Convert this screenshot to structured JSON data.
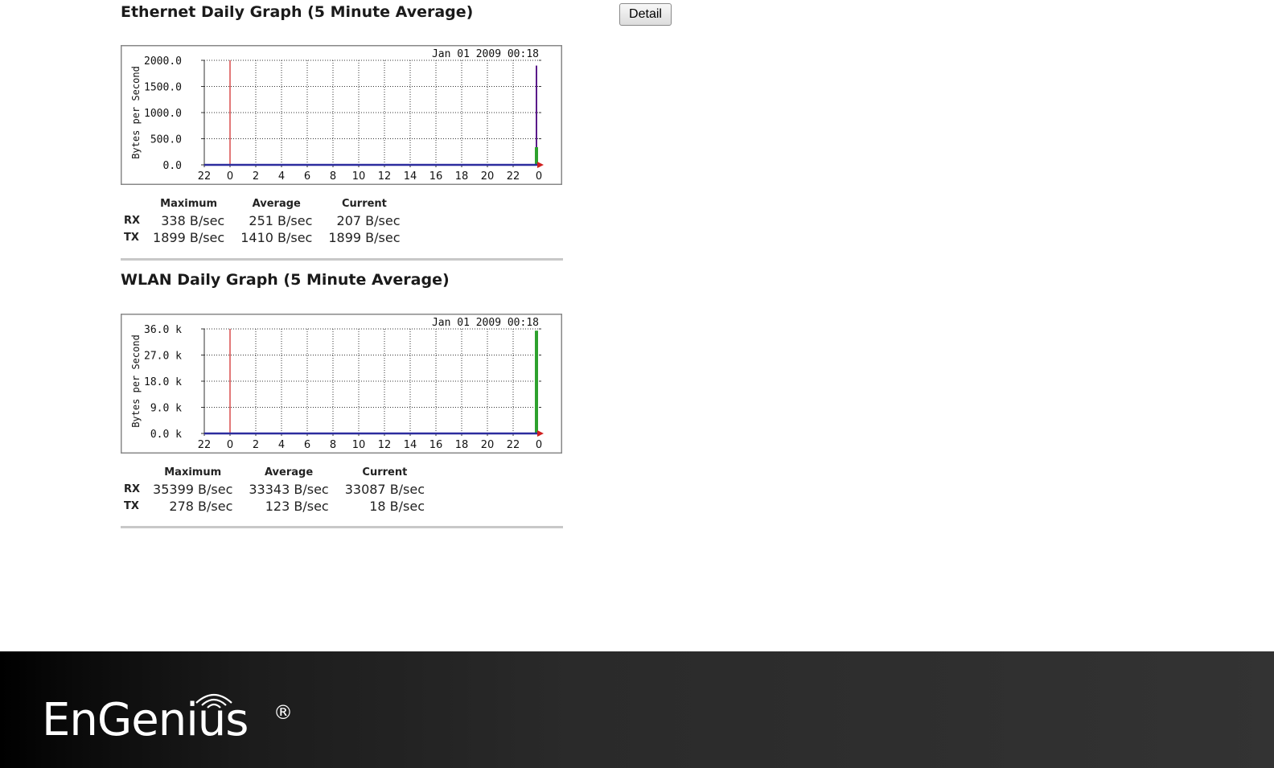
{
  "detail_button": {
    "label": "Detail"
  },
  "graphs": [
    {
      "title": "Ethernet Daily Graph (5 Minute Average)",
      "timestamp": "Jan 01 2009 00:18",
      "y_label": "Bytes per Second",
      "y_ticks": [
        "2000.0",
        "1500.0",
        "1000.0",
        "500.0",
        "0.0"
      ],
      "x_ticks": [
        "22",
        "0",
        "2",
        "4",
        "6",
        "8",
        "10",
        "12",
        "14",
        "16",
        "18",
        "20",
        "22",
        "0"
      ],
      "stats": {
        "headers": [
          "Maximum",
          "Average",
          "Current"
        ],
        "rows": [
          {
            "label": "RX",
            "values": [
              "338 B/sec",
              "251 B/sec",
              "207 B/sec"
            ]
          },
          {
            "label": "TX",
            "values": [
              "1899 B/sec",
              "1410 B/sec",
              "1899 B/sec"
            ]
          }
        ]
      }
    },
    {
      "title": "WLAN Daily Graph (5 Minute Average)",
      "timestamp": "Jan 01 2009 00:18",
      "y_label": "Bytes per Second",
      "y_ticks": [
        "36.0 k",
        "27.0 k",
        "18.0 k",
        "9.0 k",
        "0.0 k"
      ],
      "x_ticks": [
        "22",
        "0",
        "2",
        "4",
        "6",
        "8",
        "10",
        "12",
        "14",
        "16",
        "18",
        "20",
        "22",
        "0"
      ],
      "stats": {
        "headers": [
          "Maximum",
          "Average",
          "Current"
        ],
        "rows": [
          {
            "label": "RX",
            "values": [
              "35399 B/sec",
              "33343 B/sec",
              "33087 B/sec"
            ]
          },
          {
            "label": "TX",
            "values": [
              "278 B/sec",
              "123 B/sec",
              "18 B/sec"
            ]
          }
        ]
      }
    }
  ],
  "chart_data": [
    {
      "type": "area",
      "title": "Ethernet Daily Graph (5 Minute Average)",
      "ylabel": "Bytes per Second",
      "xlabel": "",
      "ylim": [
        0,
        2000
      ],
      "x_ticks": [
        "22",
        "0",
        "2",
        "4",
        "6",
        "8",
        "10",
        "12",
        "14",
        "16",
        "18",
        "20",
        "22",
        "0"
      ],
      "grid": true,
      "series": [
        {
          "name": "RX",
          "color": "#2ea12e",
          "x": [
            "00:15",
            "00:18"
          ],
          "values": [
            338,
            207
          ]
        },
        {
          "name": "TX",
          "color": "#2c2c9e",
          "x": [
            "00:15",
            "00:18"
          ],
          "values": [
            1899,
            1899
          ]
        }
      ]
    },
    {
      "type": "area",
      "title": "WLAN Daily Graph (5 Minute Average)",
      "ylabel": "Bytes per Second",
      "xlabel": "",
      "ylim": [
        0,
        36000
      ],
      "x_ticks": [
        "22",
        "0",
        "2",
        "4",
        "6",
        "8",
        "10",
        "12",
        "14",
        "16",
        "18",
        "20",
        "22",
        "0"
      ],
      "grid": true,
      "series": [
        {
          "name": "RX",
          "color": "#2ea12e",
          "x": [
            "00:15",
            "00:18"
          ],
          "values": [
            35399,
            33087
          ]
        },
        {
          "name": "TX",
          "color": "#2c2c9e",
          "x": [
            "00:15",
            "00:18"
          ],
          "values": [
            278,
            18
          ]
        }
      ]
    }
  ],
  "colors": {
    "rx": "#2ea12e",
    "tx": "#2c2c9e",
    "midnight_marker": "#d02020",
    "tx_fill": "#5a1a8a"
  },
  "footer": {
    "logo_text": "EnGenius",
    "logo_mark": "®"
  }
}
